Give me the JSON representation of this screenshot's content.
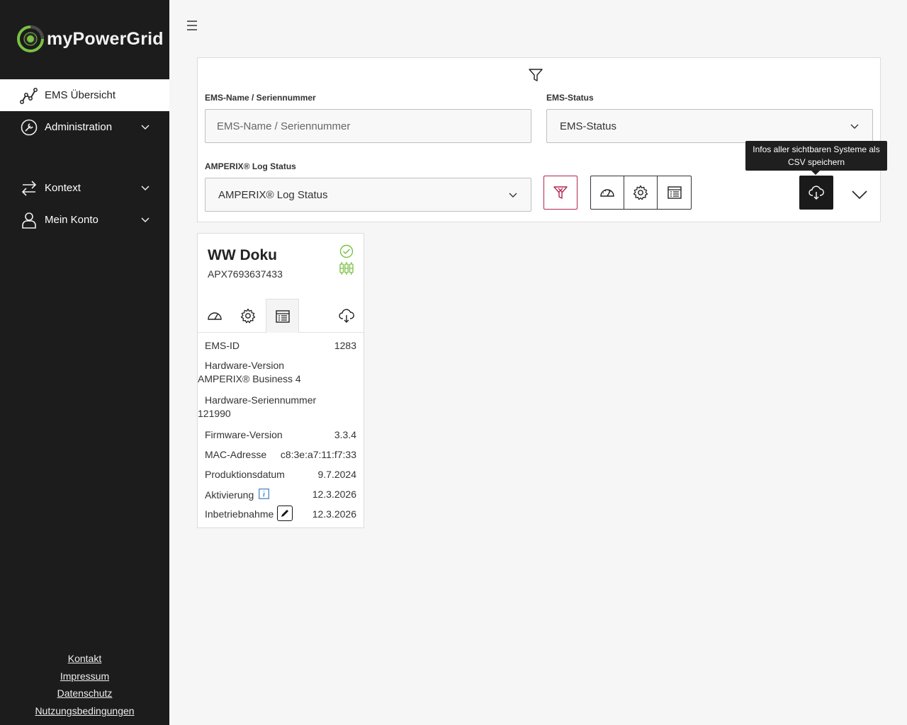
{
  "app": {
    "name": "myPowerGrid"
  },
  "sidebar": {
    "items": [
      {
        "label": "EMS Übersicht"
      },
      {
        "label": "Administration"
      },
      {
        "label": "Kontext"
      },
      {
        "label": "Mein Konto"
      }
    ],
    "footer": [
      "Kontakt",
      "Impressum",
      "Datenschutz",
      "Nutzungsbedingungen"
    ]
  },
  "filters": {
    "name_label": "EMS-Name / Seriennummer",
    "name_placeholder": "EMS-Name / Seriennummer",
    "status_label": "EMS-Status",
    "status_value": "EMS-Status",
    "log_label": "AMPERIX® Log Status",
    "log_value": "AMPERIX® Log Status"
  },
  "tooltip": {
    "line1": "Infos aller sichtbaren Systeme als",
    "line2": "CSV speichern"
  },
  "card": {
    "title": "WW Doku",
    "serial": "APX7693637433",
    "rows": {
      "ems_id": {
        "label": "EMS-ID",
        "value": "1283"
      },
      "hw_version": {
        "label": "Hardware-Version",
        "value": "AMPERIX® Business 4"
      },
      "hw_serial": {
        "label": "Hardware-Seriennummer",
        "value": "121990"
      },
      "fw_version": {
        "label": "Firmware-Version",
        "value": "3.3.4"
      },
      "mac": {
        "label": "MAC-Adresse",
        "value": "c8:3e:a7:11:f7:33"
      },
      "production": {
        "label": "Produktionsdatum",
        "value": "9.7.2024"
      },
      "activation": {
        "label": "Aktivierung",
        "value": "12.3.2026"
      },
      "commissioning": {
        "label": "Inbetriebnahme",
        "value": "12.3.2026"
      }
    }
  },
  "colors": {
    "sidebar_bg": "#1c1c1c",
    "accent_green": "#7ac143",
    "reset_red": "#b0284e",
    "info_blue": "#3d7fc1"
  }
}
